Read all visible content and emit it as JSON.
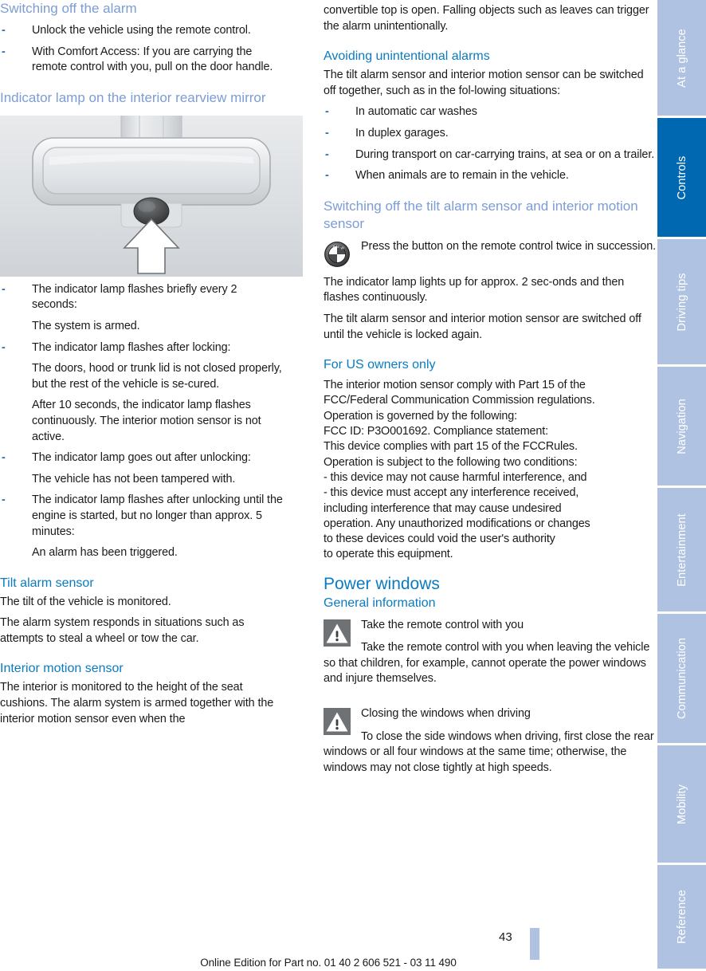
{
  "document": {
    "page_number": "43",
    "footer": "Online Edition for Part no. 01 40 2 606 521 - 03 11 490",
    "colors": {
      "heading_primary": "#0b7bc1",
      "heading_muted": "#7b9cd4",
      "tab_inactive": "#afc2e2",
      "tab_active": "#0067b1",
      "bullet_dash": "#2f6fb5",
      "body_text": "#1a1a1a"
    }
  },
  "left_column": {
    "heading_switching_off_alarm": "Switching off the alarm",
    "bullets_switching_off": [
      "Unlock the vehicle using the remote control.",
      "With Comfort Access: If you are carrying the remote control with you, pull on the door handle."
    ],
    "heading_indicator_lamp": "Indicator lamp on the interior rearview mirror",
    "figure_caption": "interior-rearview-mirror-illustration",
    "indicator_items": [
      {
        "bullet": "The indicator lamp flashes briefly every 2 seconds:",
        "continuations": [
          "The system is armed."
        ]
      },
      {
        "bullet": "The indicator lamp flashes after locking:",
        "continuations": [
          "The doors, hood or trunk lid is not closed properly, but the rest of the vehicle is se-cured.",
          "After  10 seconds, the indicator lamp flashes continuously. The interior motion sensor is not active."
        ]
      },
      {
        "bullet": "The indicator lamp goes out after unlocking:",
        "continuations": [
          "The vehicle has not been tampered with."
        ]
      },
      {
        "bullet": "The indicator lamp flashes after unlocking until the engine is started, but no longer than approx. 5 minutes:",
        "continuations": [
          "An alarm has been triggered."
        ]
      }
    ],
    "heading_tilt_alarm_sensor": "Tilt alarm sensor",
    "tilt_paragraphs": [
      "The tilt of the vehicle is monitored.",
      "The alarm system responds in situations such as attempts to steal a wheel or tow the car."
    ],
    "heading_interior_motion_sensor": "Interior motion sensor",
    "interior_paragraph": "The  interior is monitored to the height of the seat cushions. The alarm system is armed together with the interior motion sensor even when the"
  },
  "right_column": {
    "continued_paragraph": "convertible top is open. Falling objects such as leaves can trigger the alarm unintentionally.",
    "heading_avoiding_alarms": "Avoiding unintentional alarms",
    "avoiding_intro": "The  tilt alarm sensor and interior motion sensor can be switched off together, such as in the fol-lowing situations:",
    "avoiding_bullets": [
      "In automatic car washes",
      "In duplex garages.",
      "During transport on car-carrying trains, at sea or on a trailer.",
      "When animals are to remain in the vehicle."
    ],
    "heading_switching_off_sensors": "Switching off the tilt alarm sensor and interior motion sensor",
    "roundel_note": {
      "icon": "bmw-roundel-icon",
      "text": "Press the button on the remote control twice in succession."
    },
    "after_roundel_paragraphs": [
      "The indicator lamp lights up for approx. 2 sec-onds and then flashes continuously.",
      "The  tilt alarm sensor and interior motion sensor are switched off until the vehicle is locked again."
    ],
    "heading_us_owners": "For US owners only",
    "fcc_text": "The interior motion sensor comply with Part 15 of the\nFCC/Federal Communication Commission regulations.\nOperation is governed by the following:\nFCC ID: P3O001692. Compliance statement:\nThis device complies with part 15 of the FCCRules.\nOperation is subject to the following two conditions:\n- this device may not cause harmful interference, and\n- this device must accept any interference received,\nincluding interference that may cause undesired\noperation. Any unauthorized modifications or changes\nto these devices could void the user's authority\nto operate this equipment.",
    "heading_power_windows": "Power windows",
    "heading_general_information": "General information",
    "warning_notes": [
      {
        "icon": "warning-triangle-icon",
        "title": "Take the remote control with you",
        "body": "Take the remote control with you when leaving the vehicle so that children, for example, cannot operate the power windows and injure themselves."
      },
      {
        "icon": "warning-triangle-icon",
        "title": "Closing the windows when driving",
        "body": "To close the side windows when driving, first close the rear windows or all four windows at the same time; otherwise, the windows may not close tightly at high speeds."
      }
    ]
  },
  "sidebar": {
    "tabs": [
      {
        "label": "At a glance",
        "active": false,
        "height": 148
      },
      {
        "label": "Controls",
        "active": true,
        "height": 152
      },
      {
        "label": "Driving tips",
        "active": false,
        "height": 160
      },
      {
        "label": "Navigation",
        "active": false,
        "height": 152
      },
      {
        "label": "Entertainment",
        "active": false,
        "height": 158
      },
      {
        "label": "Communication",
        "active": false,
        "height": 165
      },
      {
        "label": "Mobility",
        "active": false,
        "height": 150
      },
      {
        "label": "Reference",
        "active": false,
        "height": 130
      }
    ]
  }
}
